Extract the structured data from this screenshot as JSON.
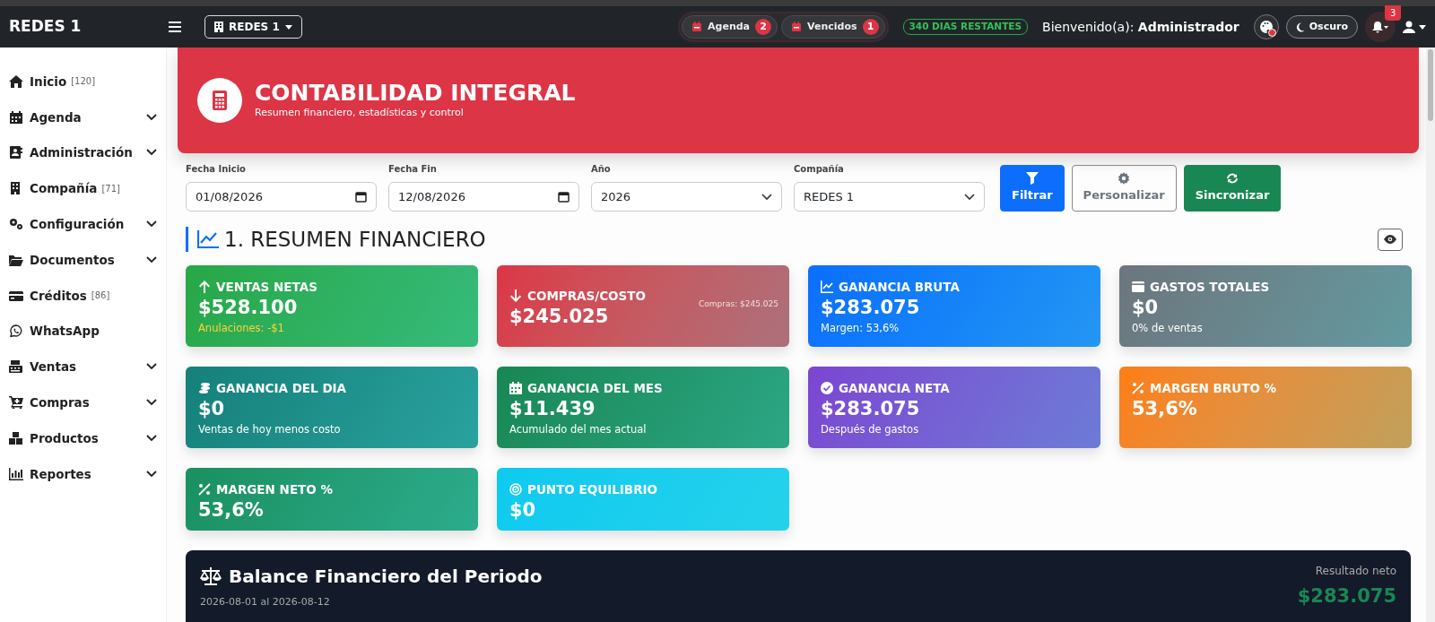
{
  "navbar": {
    "brand": "REDES 1",
    "company_menu": "REDES 1",
    "pills": [
      {
        "label": "Agenda",
        "count": "2"
      },
      {
        "label": "Vencidos",
        "count": "1"
      }
    ],
    "license_badge": "340 DIAS RESTANTES",
    "welcome": "Bienvenido(a): **Administrador**",
    "theme_button": "Oscuro",
    "notifications_count": "3"
  },
  "sidebar": {
    "items": [
      {
        "label": "Inicio",
        "count": "[120]",
        "expandable": false
      },
      {
        "label": "Agenda",
        "expandable": true
      },
      {
        "label": "Administración",
        "expandable": true
      },
      {
        "label": "Compañía",
        "count": "[71]",
        "expandable": false
      },
      {
        "label": "Configuración",
        "expandable": true
      },
      {
        "label": "Documentos",
        "expandable": true
      },
      {
        "label": "Créditos",
        "count": "[86]",
        "expandable": false
      },
      {
        "label": "WhatsApp",
        "expandable": false
      },
      {
        "label": "Ventas",
        "expandable": true
      },
      {
        "label": "Compras",
        "expandable": true
      },
      {
        "label": "Productos",
        "expandable": true
      },
      {
        "label": "Reportes",
        "expandable": true
      }
    ]
  },
  "header": {
    "title": "CONTABILIDAD INTEGRAL",
    "subtitle": "Resumen financiero, estadísticas y control"
  },
  "filters": [
    {
      "kind": "date",
      "label": "Fecha Inicio",
      "value": "01/08/2026"
    },
    {
      "kind": "date",
      "label": "Fecha Fin",
      "value": "12/08/2026"
    },
    {
      "kind": "select",
      "label": "Año",
      "value": "2026"
    },
    {
      "kind": "select",
      "label": "Compañía",
      "value": "REDES 1"
    }
  ],
  "actions": [
    {
      "kind": "primary",
      "label": "Filtrar"
    },
    {
      "kind": "outline",
      "label": "Personalizar"
    },
    {
      "kind": "sync",
      "label": "Sincronizar"
    }
  ],
  "section": {
    "title": "1. RESUMEN FINANCIERO"
  },
  "cards": [
    {
      "color": "#28a745",
      "title": "VENTAS NETAS",
      "value": "$528.100",
      "note": "Anulaciones: -$1",
      "note_warning": true
    },
    {
      "color": "#dc3545",
      "title": "COMPRAS/COSTO",
      "value": "$245.025",
      "aside": "Compras: $245.025"
    },
    {
      "color": "#0d6efd",
      "title": "GANANCIA BRUTA",
      "value": "$283.075",
      "note": "Margen: 53,6%",
      "note_warning": false
    },
    {
      "color": "#6c757d",
      "title": "GASTOS TOTALES",
      "value": "$0",
      "note": "0% de ventas",
      "note_warning": false
    },
    {
      "color": "#15807a",
      "title": "GANANCIA DEL DIA",
      "value": "$0",
      "note": "Ventas de hoy menos costo",
      "note_warning": false
    },
    {
      "color": "#198754",
      "title": "GANANCIA DEL MES",
      "value": "$11.439",
      "note": "Acumulado del mes actual",
      "note_warning": false
    },
    {
      "color": "#7b45d1",
      "title": "GANANCIA NETA",
      "value": "$283.075",
      "note": "Después de gastos",
      "note_warning": false
    },
    {
      "color": "#fd7e14",
      "title": "MARGEN BRUTO %",
      "value": "53,6%"
    },
    {
      "color": "#1a9060",
      "title": "MARGEN NETO %",
      "value": "53,6%"
    },
    {
      "color": "#0dcaf0",
      "title": "PUNTO EQUILIBRIO",
      "value": "$0"
    }
  ],
  "balance": {
    "title": "Balance Financiero del Periodo",
    "period": "2026-08-01 al 2026-08-12",
    "result_label": "Resultado neto",
    "result_value": "$283.075"
  }
}
